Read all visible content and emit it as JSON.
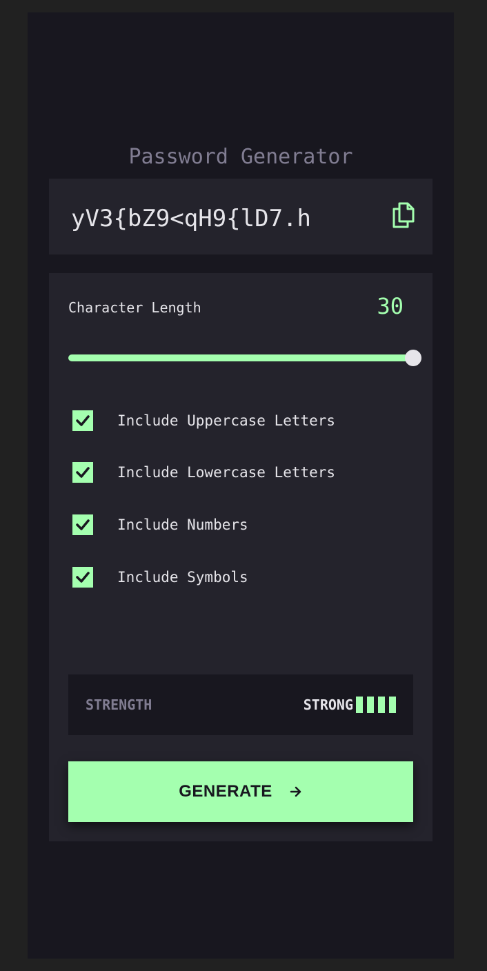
{
  "app": {
    "title": "Password Generator"
  },
  "output": {
    "password": "yV3{bZ9<qH9{lD7.h",
    "copy_icon": "copy-icon"
  },
  "length": {
    "label": "Character Length",
    "value": "30",
    "slider_fraction": 1.0
  },
  "options": [
    {
      "label": "Include Uppercase Letters",
      "checked": true
    },
    {
      "label": "Include Lowercase Letters",
      "checked": true
    },
    {
      "label": "Include Numbers",
      "checked": true
    },
    {
      "label": "Include Symbols",
      "checked": true
    }
  ],
  "strength": {
    "label": "STRENGTH",
    "value": "STRONG",
    "bars_filled": 4,
    "bars_total": 4
  },
  "generate": {
    "label": "GENERATE",
    "icon": "arrow-right-icon"
  },
  "colors": {
    "accent": "#a4ffaf",
    "background": "#18171f",
    "panel": "#24232c",
    "muted": "#817d92",
    "text": "#e6e5ea"
  }
}
